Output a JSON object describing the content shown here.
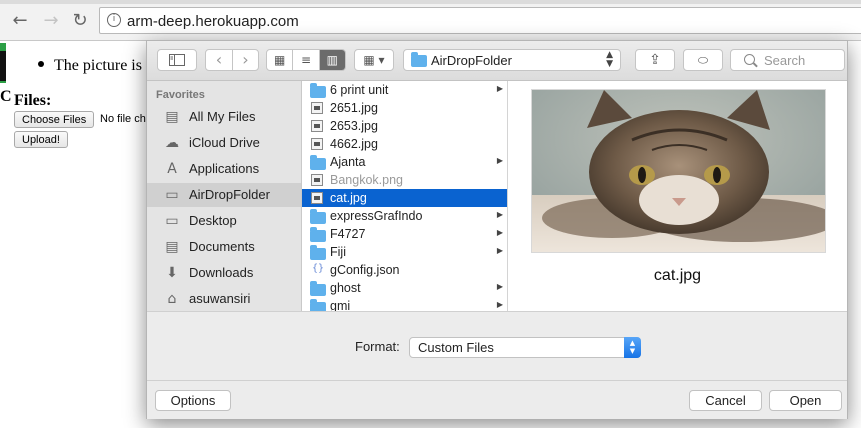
{
  "browser": {
    "url": "arm-deep.herokuapp.com",
    "back_icon": "←",
    "forward_icon": "→",
    "reload_icon": "↻",
    "info_icon": "i"
  },
  "page": {
    "bullet_text": "The picture is",
    "cut_letter": "C",
    "files_label": "Files:",
    "choose_files_label": "Choose Files",
    "no_file_text": "No file ch",
    "upload_label": "Upload!"
  },
  "dialog": {
    "toolbar": {
      "sidebar_toggle_icon": "sidebar-icon",
      "back_icon": "‹",
      "forward_icon": "›",
      "view_icons": "▦",
      "view_list": "≡",
      "view_columns": "▥",
      "arrange_icon": "▦ ▾",
      "location": "AirDropFolder",
      "location_arrows": "⌃⌄",
      "share_icon": "⇪",
      "tag_icon": "⬭",
      "search_placeholder": "Search"
    },
    "sidebar": {
      "heading": "Favorites",
      "items": [
        {
          "label": "All My Files",
          "icon": "▤"
        },
        {
          "label": "iCloud Drive",
          "icon": "☁"
        },
        {
          "label": "Applications",
          "icon": "A"
        },
        {
          "label": "AirDropFolder",
          "icon": "▭"
        },
        {
          "label": "Desktop",
          "icon": "▭"
        },
        {
          "label": "Documents",
          "icon": "▤"
        },
        {
          "label": "Downloads",
          "icon": "⬇"
        },
        {
          "label": "asuwansiri",
          "icon": "⌂"
        }
      ]
    },
    "files": [
      {
        "name": "6 print unit",
        "type": "folder"
      },
      {
        "name": "2651.jpg",
        "type": "image"
      },
      {
        "name": "2653.jpg",
        "type": "image"
      },
      {
        "name": "4662.jpg",
        "type": "image"
      },
      {
        "name": "Ajanta",
        "type": "folder"
      },
      {
        "name": "Bangkok.png",
        "type": "dim"
      },
      {
        "name": "cat.jpg",
        "type": "image"
      },
      {
        "name": "expressGrafIndo",
        "type": "folder"
      },
      {
        "name": "F4727",
        "type": "folder"
      },
      {
        "name": "Fiji",
        "type": "folder"
      },
      {
        "name": "gConfig.json",
        "type": "json"
      },
      {
        "name": "ghost",
        "type": "folder"
      },
      {
        "name": "gmi",
        "type": "folder"
      }
    ],
    "selected_file": "cat.jpg",
    "preview_name": "cat.jpg",
    "format_label": "Format:",
    "format_value": "Custom Files",
    "options_label": "Options",
    "cancel_label": "Cancel",
    "open_label": "Open",
    "accent_color": "#0a63d0"
  }
}
